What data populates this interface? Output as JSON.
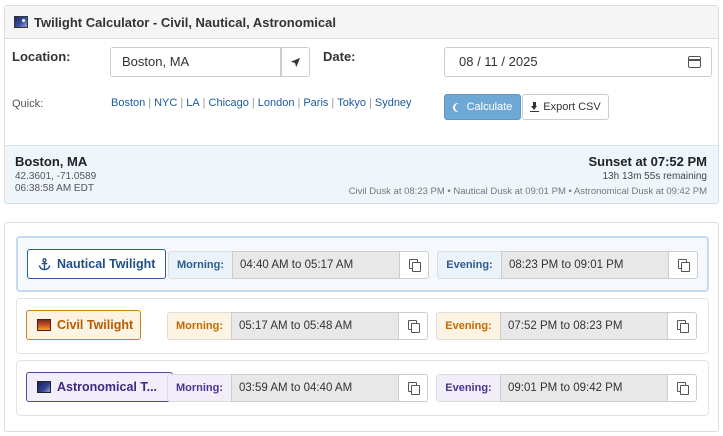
{
  "app": {
    "title": "Twilight Calculator - Civil, Nautical, Astronomical"
  },
  "form": {
    "location_label": "Location:",
    "location_value": "Boston, MA",
    "date_label": "Date:",
    "date_value": "08 / 11 / 2025",
    "quick_label": "Quick:",
    "quick_links": [
      "Boston",
      "NYC",
      "LA",
      "Chicago",
      "London",
      "Paris",
      "Tokyo",
      "Sydney"
    ],
    "calculate_label": "Calculate",
    "export_label": "Export CSV"
  },
  "summary": {
    "city": "Boston, MA",
    "coords": "42.3601, -71.0589",
    "local_time": "06:38:58 AM EDT",
    "sunset": "Sunset at 07:52 PM",
    "remaining": "13h 13m 55s remaining",
    "dusks": "Civil Dusk at 08:23 PM • Nautical Dusk at 09:01 PM • Astronomical Dusk at 09:42 PM"
  },
  "rows": [
    {
      "name": "Nautical Twilight",
      "icon": "anchor-icon",
      "morning_label": "Morning:",
      "morning": "04:40 AM to 05:17 AM",
      "evening_label": "Evening:",
      "evening": "08:23 PM to 09:01 PM"
    },
    {
      "name": "Civil Twilight",
      "icon": "sunset-icon",
      "morning_label": "Morning:",
      "morning": "05:17 AM to 05:48 AM",
      "evening_label": "Evening:",
      "evening": "07:52 PM to 08:23 PM"
    },
    {
      "name": "Astronomical T...",
      "icon": "night-sky-icon",
      "morning_label": "Morning:",
      "morning": "03:59 AM to 04:40 AM",
      "evening_label": "Evening:",
      "evening": "09:01 PM to 09:42 PM"
    }
  ],
  "colors": {
    "accent": "#6ea9d6",
    "nautical": "#1f4e8a",
    "civil": "#b85a00",
    "astronomical": "#3f2a80"
  }
}
